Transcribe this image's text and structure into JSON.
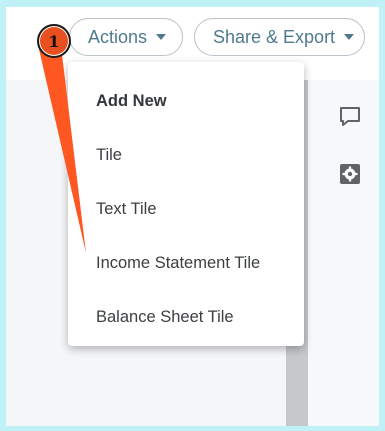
{
  "toolbar": {
    "actions_label": "Actions",
    "share_export_label": "Share & Export"
  },
  "dropdown": {
    "header": "Add New",
    "items": [
      "Tile",
      "Text Tile",
      "Income Statement Tile",
      "Balance Sheet Tile"
    ]
  },
  "marker": {
    "number": "1",
    "color": "#e8501f"
  },
  "side_icons": [
    "comment-icon",
    "settings-icon"
  ],
  "colors": {
    "page_border": "#c0f1f7",
    "button_text": "#4f7a8e"
  }
}
